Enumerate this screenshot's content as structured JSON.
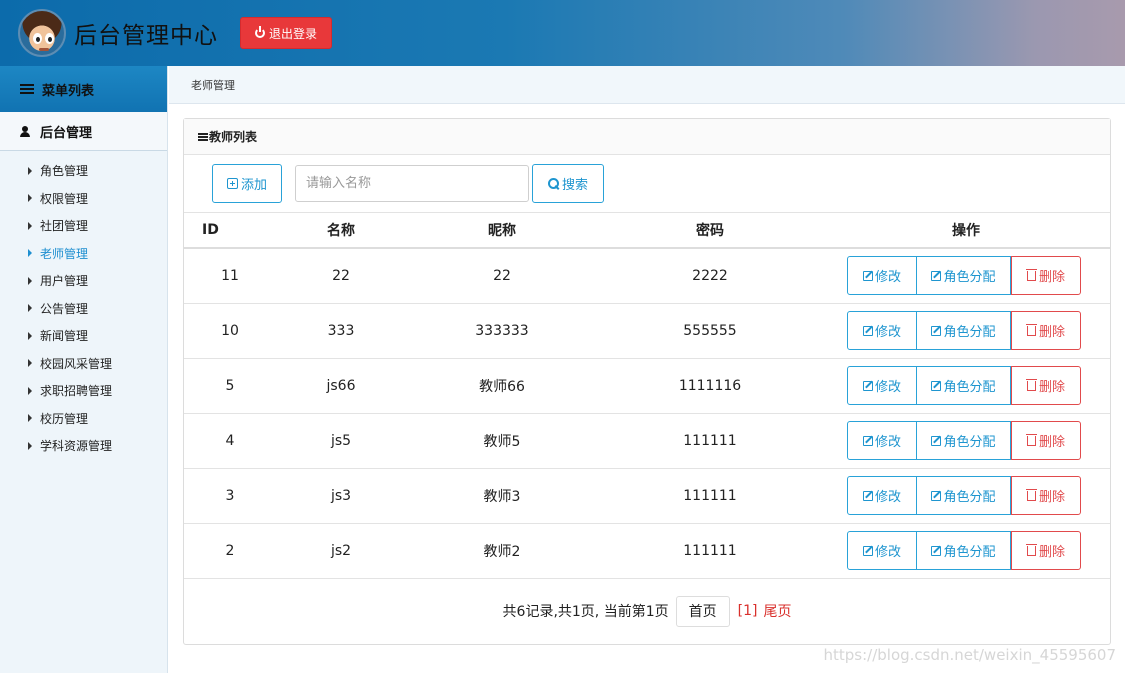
{
  "header": {
    "title": "后台管理中心",
    "logout_label": "退出登录"
  },
  "sidebar": {
    "menu_title": "菜单列表",
    "section_title": "后台管理",
    "items": [
      {
        "label": "角色管理"
      },
      {
        "label": "权限管理"
      },
      {
        "label": "社团管理"
      },
      {
        "label": "老师管理"
      },
      {
        "label": "用户管理"
      },
      {
        "label": "公告管理"
      },
      {
        "label": "新闻管理"
      },
      {
        "label": "校园风采管理"
      },
      {
        "label": "求职招聘管理"
      },
      {
        "label": "校历管理"
      },
      {
        "label": "学科资源管理"
      }
    ],
    "active_index": 3
  },
  "breadcrumb": "老师管理",
  "panel": {
    "title": "教师列表",
    "add_label": "添加",
    "search_placeholder": "请输入名称",
    "search_label": "搜索"
  },
  "table": {
    "headers": {
      "id": "ID",
      "name": "名称",
      "nickname": "昵称",
      "password": "密码",
      "actions": "操作"
    },
    "rows": [
      {
        "id": "11",
        "name": "22",
        "nickname": "22",
        "password": "2222"
      },
      {
        "id": "10",
        "name": "333",
        "nickname": "333333",
        "password": "555555"
      },
      {
        "id": "5",
        "name": "js66",
        "nickname": "教师66",
        "password": "1111116"
      },
      {
        "id": "4",
        "name": "js5",
        "nickname": "教师5",
        "password": "111111"
      },
      {
        "id": "3",
        "name": "js3",
        "nickname": "教师3",
        "password": "111111"
      },
      {
        "id": "2",
        "name": "js2",
        "nickname": "教师2",
        "password": "111111"
      }
    ],
    "actions": {
      "edit": "修改",
      "role": "角色分配",
      "delete": "删除"
    }
  },
  "pager": {
    "summary": "共6记录,共1页, 当前第1页",
    "first": "首页",
    "current": "[1]",
    "last": "尾页"
  },
  "watermark": "https://blog.csdn.net/weixin_45595607",
  "colors": {
    "accent": "#1e95cf",
    "danger": "#e14a4c",
    "logout": "#e8383a"
  }
}
